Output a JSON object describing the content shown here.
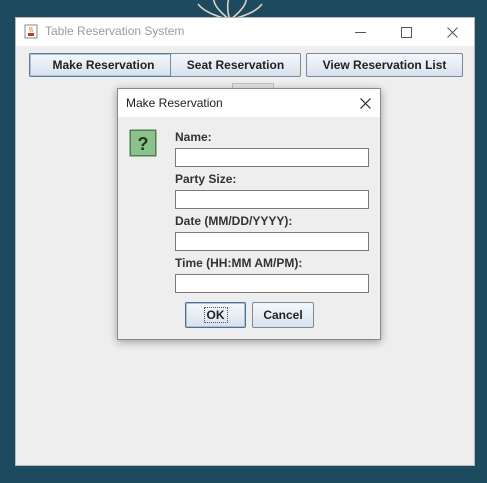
{
  "window": {
    "title": "Table Reservation System"
  },
  "toolbar": {
    "make_label": "Make Reservation",
    "seat_label": "Seat Reservation",
    "view_label": "View Reservation List"
  },
  "dialog": {
    "title": "Make Reservation",
    "icon": "question-icon",
    "fields": [
      {
        "label": "Name:",
        "value": ""
      },
      {
        "label": "Party Size:",
        "value": ""
      },
      {
        "label": "Date (MM/DD/YYYY):",
        "value": ""
      },
      {
        "label": "Time (HH:MM AM/PM):",
        "value": ""
      }
    ],
    "ok_label": "OK",
    "cancel_label": "Cancel"
  },
  "colors": {
    "desktop": "#1d4a5e",
    "window_bg": "#eeeeee",
    "button_border": "#7a8a99",
    "icon_green": "#8cc08c"
  }
}
